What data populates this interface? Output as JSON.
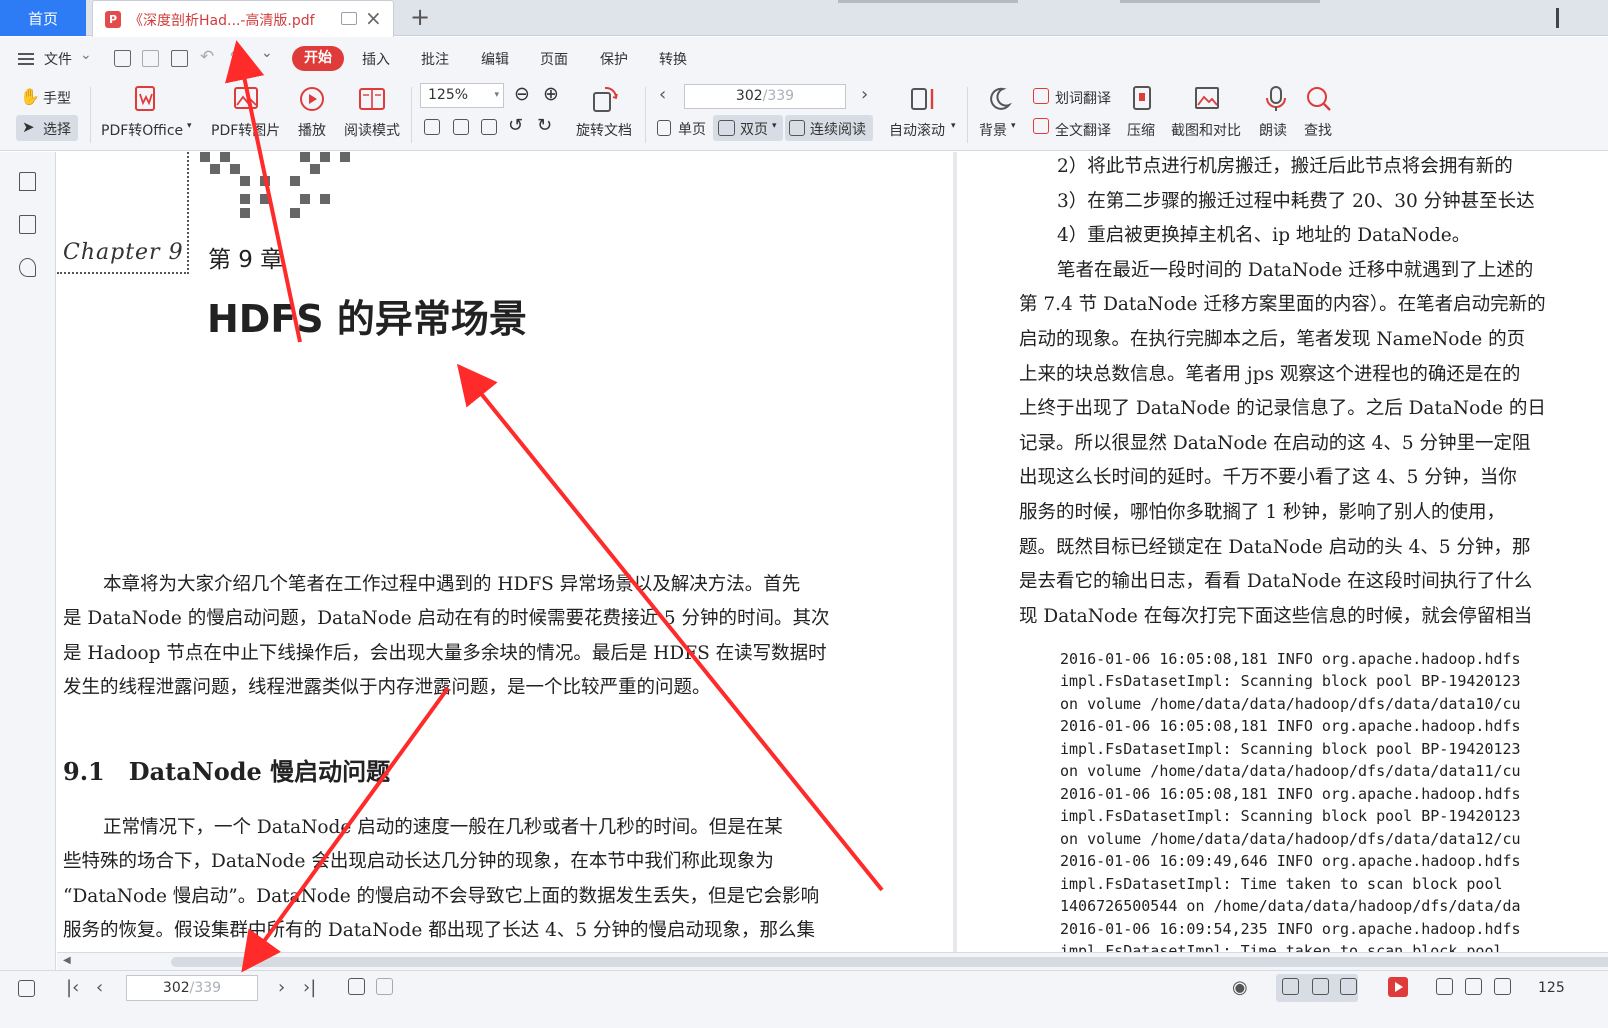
{
  "tabs": {
    "home": "首页",
    "document": "《深度剖析Had...-高清版.pdf"
  },
  "menu": {
    "file": "文件",
    "items": [
      "开始",
      "插入",
      "批注",
      "编辑",
      "页面",
      "保护",
      "转换"
    ]
  },
  "ribbon": {
    "hand": "手型",
    "select": "选择",
    "pdf_to_office": "PDF转Office",
    "pdf_to_image": "PDF转图片",
    "play": "播放",
    "read_mode": "阅读模式",
    "zoom": "125%",
    "rotate_doc": "旋转文档",
    "single_page": "单页",
    "double_page": "双页",
    "continuous": "连续阅读",
    "page_current": "302",
    "page_total": "/339",
    "auto_scroll": "自动滚动",
    "background": "背景",
    "word_translate": "划词翻译",
    "full_translate": "全文翻译",
    "compress": "压缩",
    "screenshot_compare": "截图和对比",
    "read_aloud": "朗读",
    "find": "查找"
  },
  "left_page": {
    "chapter_script": "Chapter 9",
    "chapter_no": "第 9 章",
    "chapter_title": "HDFS 的异常场景",
    "intro": [
      "本章将为大家介绍几个笔者在工作过程中遇到的 HDFS 异常场景以及解决方法。首先",
      "是 DataNode 的慢启动问题，DataNode 启动在有的时候需要花费接近 5 分钟的时间。其次",
      "是 Hadoop 节点在中止下线操作后，会出现大量多余块的情况。最后是 HDFS 在读写数据时",
      "发生的线程泄露问题，线程泄露类似于内存泄露问题，是一个比较严重的问题。"
    ],
    "section_title": "9.1　DataNode 慢启动问题",
    "section_body": [
      "正常情况下，一个 DataNode 启动的速度一般在几秒或者十几秒的时间。但是在某",
      "些特殊的场合下，DataNode 会出现启动长达几分钟的现象，在本节中我们称此现象为",
      "“DataNode 慢启动”。DataNode 的慢启动不会导致它上面的数据发生丢失，但是它会影响",
      "服务的恢复。假设集群中所有的 DataNode 都出现了长达 4、5 分钟的慢启动现象，那么集"
    ]
  },
  "right_page": {
    "lines": [
      "2）将此节点进行机房搬迁，搬迁后此节点将会拥有新的",
      "3）在第二步骤的搬迁过程中耗费了 20、30 分钟甚至长达",
      "4）重启被更换掉主机名、ip 地址的 DataNode。",
      "笔者在最近一段时间的 DataNode 迁移中就遇到了上述的",
      "第 7.4 节 DataNode 迁移方案里面的内容）。在笔者启动完新的",
      "启动的现象。在执行完脚本之后，笔者发现 NameNode 的页",
      "上来的块总数信息。笔者用 jps 观察这个进程也的确还是在的",
      "上终于出现了 DataNode 的记录信息了。之后 DataNode 的日",
      "记录。所以很显然 DataNode 在启动的这 4、5 分钟里一定阻",
      "出现这么长时间的延时。千万不要小看了这 4、5 分钟，当你",
      "服务的时候，哪怕你多耽搁了 1 秒钟，影响了别人的使用，",
      "题。既然目标已经锁定在 DataNode 启动的头 4、5 分钟，那",
      "是去看它的输出日志，看看 DataNode 在这段时间执行了什么",
      "现 DataNode 在每次打完下面这些信息的时候，就会停留相当"
    ],
    "log": [
      "2016-01-06 16:05:08,181 INFO org.apache.hadoop.hdfs",
      "  impl.FsDatasetImpl: Scanning block pool BP-19420123",
      "  on volume /home/data/data/hadoop/dfs/data/data10/cu",
      "2016-01-06 16:05:08,181 INFO org.apache.hadoop.hdfs",
      "  impl.FsDatasetImpl: Scanning block pool BP-19420123",
      "  on volume /home/data/data/hadoop/dfs/data/data11/cu",
      "2016-01-06 16:05:08,181 INFO org.apache.hadoop.hdfs",
      "  impl.FsDatasetImpl: Scanning block pool BP-19420123",
      "  on volume /home/data/data/hadoop/dfs/data/data12/cu",
      "2016-01-06 16:09:49,646 INFO org.apache.hadoop.hdfs",
      "  impl.FsDatasetImpl: Time taken to scan block pool",
      "  1406726500544 on /home/data/data/hadoop/dfs/data/da",
      "2016-01-06 16:09:54,235 INFO org.apache.hadoop.hdfs",
      "  impl.FsDatasetImpl: Time taken to scan block pool"
    ]
  },
  "bottom": {
    "page_current": "302",
    "page_total": "/339",
    "zoom": "125"
  },
  "colors": {
    "accent_blue": "#2d7cf6",
    "accent_red": "#e03b3b",
    "annotation_red": "#ff2a2a"
  }
}
